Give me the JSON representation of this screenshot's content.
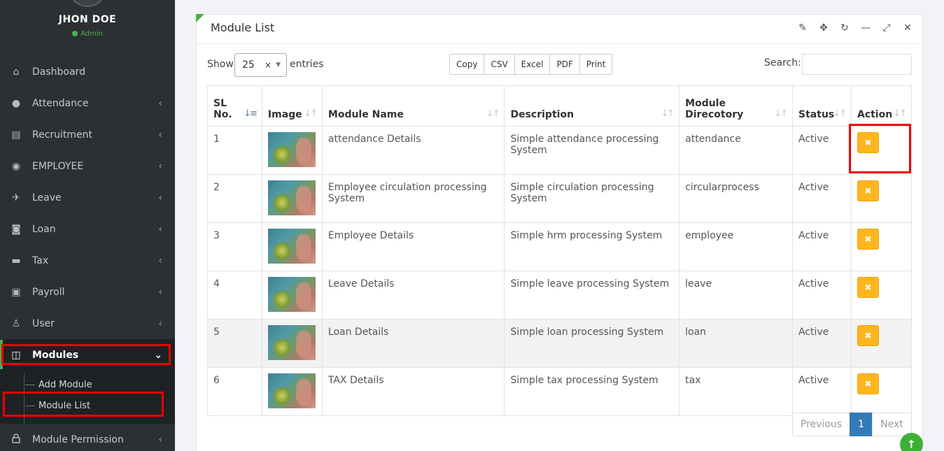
{
  "user": {
    "name": "JHON DOE",
    "role": "Admin"
  },
  "menu": [
    {
      "label": "Dashboard",
      "icon": "home-icon",
      "glyph": "⌂",
      "has_chevron": false
    },
    {
      "label": "Attendance",
      "icon": "user-icon",
      "glyph": "●",
      "has_chevron": true
    },
    {
      "label": "Recruitment",
      "icon": "id-card-icon",
      "glyph": "▤",
      "has_chevron": true
    },
    {
      "label": "EMPLOYEE",
      "icon": "users-icon",
      "glyph": "◉",
      "has_chevron": true
    },
    {
      "label": "Leave",
      "icon": "plane-icon",
      "glyph": "✈",
      "has_chevron": true
    },
    {
      "label": "Loan",
      "icon": "money-icon",
      "glyph": "◙",
      "has_chevron": true
    },
    {
      "label": "Tax",
      "icon": "credit-card-icon",
      "glyph": "▬",
      "has_chevron": true
    },
    {
      "label": "Payroll",
      "icon": "wallet-icon",
      "glyph": "▣",
      "has_chevron": true
    },
    {
      "label": "User",
      "icon": "user-outline-icon",
      "glyph": "♙",
      "has_chevron": true
    },
    {
      "label": "Modules",
      "icon": "cube-icon",
      "glyph": "◫",
      "has_chevron": true
    },
    {
      "label": "Module Permission",
      "icon": "lock-icon",
      "glyph": "🔒",
      "has_chevron": true
    }
  ],
  "submenu": [
    {
      "label": "Add Module"
    },
    {
      "label": "Module List"
    }
  ],
  "panel": {
    "title": "Module List"
  },
  "controls": {
    "show_label": "Show",
    "entries_value": "25",
    "entries_label": "entries",
    "search_label": "Search:",
    "search_value": "",
    "export_buttons": [
      "Copy",
      "CSV",
      "Excel",
      "PDF",
      "Print"
    ]
  },
  "table": {
    "headers": {
      "sl_a": "SL",
      "sl_b": "No.",
      "image": "Image",
      "name": "Module Name",
      "description": "Description",
      "dir_a": "Module",
      "dir_b": "Direcotory",
      "status": "Status",
      "action": "Action"
    },
    "rows": [
      {
        "sl": "1",
        "name": "attendance Details",
        "description": "Simple attendance processing System",
        "directory": "attendance",
        "status": "Active"
      },
      {
        "sl": "2",
        "name": "Employee circulation processing System",
        "description": "Simple circulation processing System",
        "directory": "circularprocess",
        "status": "Active"
      },
      {
        "sl": "3",
        "name": "Employee Details",
        "description": "Simple hrm processing System",
        "directory": "employee",
        "status": "Active"
      },
      {
        "sl": "4",
        "name": "Leave Details",
        "description": "Simple leave processing System",
        "directory": "leave",
        "status": "Active"
      },
      {
        "sl": "5",
        "name": "Loan Details",
        "description": "Simple loan processing System",
        "directory": "loan",
        "status": "Active"
      },
      {
        "sl": "6",
        "name": "TAX Details",
        "description": "Simple tax processing System",
        "directory": "tax",
        "status": "Active"
      }
    ]
  },
  "pagination": {
    "previous": "Previous",
    "current": "1",
    "next": "Next"
  },
  "colors": {
    "accent_green": "#4cae4c",
    "action_yellow": "#ffb61e",
    "highlight_red": "#ee0000",
    "page_active": "#337ab7"
  }
}
